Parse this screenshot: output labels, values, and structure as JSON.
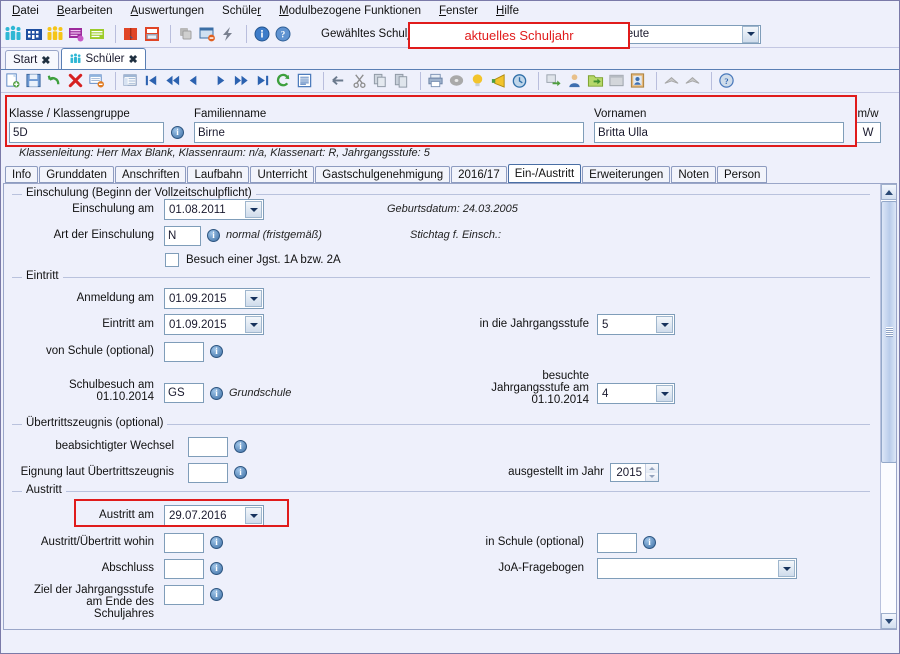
{
  "menu": {
    "items": [
      {
        "label": "Datei",
        "accel": "D"
      },
      {
        "label": "Bearbeiten",
        "accel": "B"
      },
      {
        "label": "Auswertungen",
        "accel": "A"
      },
      {
        "label": "Schüler",
        "accel": "r"
      },
      {
        "label": "Modulbezogene Funktionen",
        "accel": "M"
      },
      {
        "label": "Fenster",
        "accel": "F"
      },
      {
        "label": "Hilfe",
        "accel": "H"
      }
    ]
  },
  "main_toolbar": {
    "icons": [
      "students-icon",
      "school-building-icon",
      "persons-icon",
      "message-board-icon",
      "list-green-icon",
      "separator",
      "book-red-icon",
      "printer-report-icon",
      "separator",
      "modules-grey-icon",
      "window-close-icon",
      "lightning-icon",
      "separator",
      "info-icon",
      "help-icon"
    ],
    "schuljahr_label": "Gewähltes Schuljahr",
    "schuljahr_value": "",
    "stichtag_value": "",
    "date_mode_value": "Heute"
  },
  "doc_tabs": [
    {
      "label": "Start",
      "icon": "",
      "active": false,
      "closable": true
    },
    {
      "label": "Schüler",
      "icon": "students-icon",
      "active": true,
      "closable": true
    }
  ],
  "record_toolbar": {
    "icons": [
      "new-record-icon",
      "save-icon",
      "undo-icon",
      "delete-icon",
      "record-remove-icon",
      "separator",
      "table-view-icon",
      "first-record-icon",
      "fast-back-icon",
      "prev-record-icon",
      "next-record-icon",
      "fast-forward-icon",
      "last-record-icon",
      "refresh-icon",
      "list-icon",
      "separator",
      "back-arrow-icon",
      "cut-icon",
      "copy-icon",
      "paste-icon",
      "separator",
      "print-icon",
      "cd-icon",
      "bulb-icon",
      "megaphone-icon",
      "clock-icon",
      "separator",
      "export-icon",
      "user-icon",
      "folder-export-icon",
      "window-grey-icon",
      "photo-icon",
      "separator",
      "collapse-icon",
      "collapse-all-icon",
      "separator",
      "help-round-icon"
    ]
  },
  "header": {
    "klasse_label": "Klasse / Klassengruppe",
    "klasse_value": "5D",
    "familienname_label": "Familienname",
    "familienname_value": "Birne",
    "vornamen_label": "Vornamen",
    "vornamen_value": "Britta Ulla",
    "mw_label": "m/w",
    "mw_value": "W",
    "klassenleitung": "Klassenleitung: Herr Max Blank, Klassenraum: n/a, Klassenart: R, Jahrgangsstufe: 5"
  },
  "inner_tabs": [
    {
      "label": "Info",
      "active": false
    },
    {
      "label": "Grunddaten",
      "active": false
    },
    {
      "label": "Anschriften",
      "active": false
    },
    {
      "label": "Laufbahn",
      "active": false
    },
    {
      "label": "Unterricht",
      "active": false
    },
    {
      "label": "Gastschulgenehmigung",
      "active": false
    },
    {
      "label": "2016/17",
      "active": false
    },
    {
      "label": "Ein-/Austritt",
      "active": true
    },
    {
      "label": "Erweiterungen",
      "active": false
    },
    {
      "label": "Noten",
      "active": false
    },
    {
      "label": "Person",
      "active": false
    }
  ],
  "form": {
    "einschulung": {
      "group_title": "Einschulung (Beginn der Vollzeitschulpflicht)",
      "einschulung_am_label": "Einschulung am",
      "einschulung_am_value": "01.08.2011",
      "art_label": "Art der Einschulung",
      "art_value": "N",
      "art_hint": "normal (fristgemäß)",
      "checkbox_label": "Besuch einer Jgst. 1A bzw. 2A",
      "checkbox_checked": false,
      "geburtsdatum": "Geburtsdatum: 24.03.2005",
      "stichtag": "Stichtag f. Einsch.:"
    },
    "eintritt": {
      "group_title": "Eintritt",
      "anmeldung_label": "Anmeldung am",
      "anmeldung_value": "01.09.2015",
      "eintritt_label": "Eintritt am",
      "eintritt_value": "01.09.2015",
      "von_schule_label": "von Schule (optional)",
      "von_schule_value": "",
      "schulbesuch_label_line1": "Schulbesuch am",
      "schulbesuch_label_line2": "01.10.2014",
      "schulbesuch_value": "GS",
      "schulbesuch_hint": "Grundschule",
      "jahrgangsstufe_label": "in die Jahrgangsstufe",
      "jahrgangsstufe_value": "5",
      "besuchte_label_line1": "besuchte",
      "besuchte_label_line2": "Jahrgangsstufe am",
      "besuchte_label_line3": "01.10.2014",
      "besuchte_value": "4"
    },
    "uebertritt": {
      "group_title": "Übertrittszeugnis (optional)",
      "wechsel_label": "beabsichtigter Wechsel",
      "wechsel_value": "",
      "eignung_label": "Eignung laut Übertrittszeugnis",
      "eignung_value": "",
      "ausgestellt_label": "ausgestellt im Jahr",
      "ausgestellt_value": "2015"
    },
    "austritt": {
      "group_title": "Austritt",
      "austritt_am_label": "Austritt am",
      "austritt_am_value": "29.07.2016",
      "wohin_label": "Austritt/Übertritt wohin",
      "wohin_value": "",
      "abschluss_label": "Abschluss",
      "abschluss_value": "",
      "ziel_label_line1": "Ziel der Jahrgangsstufe",
      "ziel_label_line2": "am Ende des",
      "ziel_label_line3": "Schuljahres",
      "ziel_value": "",
      "in_schule_label": "in Schule (optional)",
      "in_schule_value": "",
      "joa_label": "JoA-Fragebogen",
      "joa_value": ""
    }
  },
  "annotations": {
    "schuljahr_note": "aktuelles Schuljahr",
    "accent_red": "#e01b1b"
  }
}
